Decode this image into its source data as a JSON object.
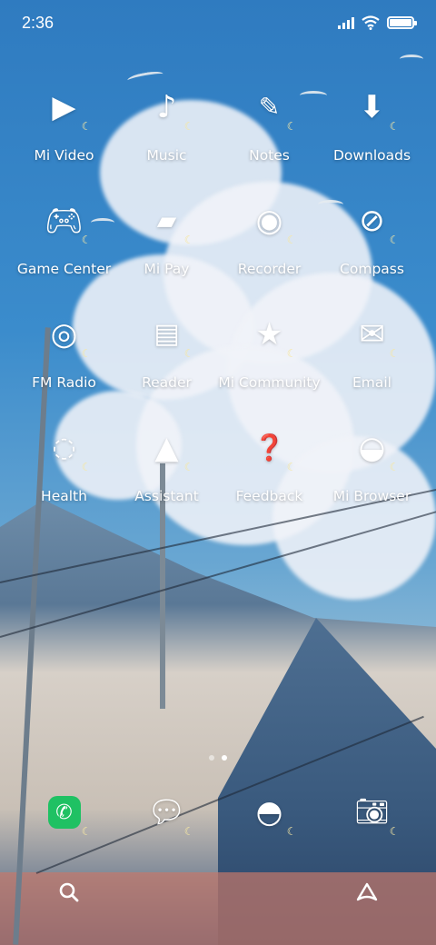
{
  "status_bar": {
    "time": "2:36",
    "icons": [
      "signal-icon",
      "wifi-icon",
      "battery-icon"
    ],
    "battery_level": 1.0
  },
  "apps": [
    {
      "label": "Mi Video",
      "icon": "play-icon"
    },
    {
      "label": "Music",
      "icon": "music-note-icon"
    },
    {
      "label": "Notes",
      "icon": "pencil-icon"
    },
    {
      "label": "Downloads",
      "icon": "download-icon"
    },
    {
      "label": "Game Center",
      "icon": "gamepad-icon"
    },
    {
      "label": "Mi Pay",
      "icon": "card-icon"
    },
    {
      "label": "Recorder",
      "icon": "record-icon"
    },
    {
      "label": "Compass",
      "icon": "compass-icon"
    },
    {
      "label": "FM Radio",
      "icon": "radio-icon"
    },
    {
      "label": "Reader",
      "icon": "book-icon"
    },
    {
      "label": "Mi Community",
      "icon": "community-icon"
    },
    {
      "label": "Email",
      "icon": "mail-icon"
    },
    {
      "label": "Health",
      "icon": "health-icon"
    },
    {
      "label": "Assistant",
      "icon": "assistant-icon"
    },
    {
      "label": "Feedback",
      "icon": "feedback-icon"
    },
    {
      "label": "Mi Browser",
      "icon": "globe-icon"
    }
  ],
  "page_indicator": {
    "pages": 2,
    "current": 2
  },
  "dock": [
    {
      "icon": "phone-icon"
    },
    {
      "icon": "messaging-icon"
    },
    {
      "icon": "browser-icon"
    },
    {
      "icon": "camera-icon"
    }
  ],
  "bottom_bar": {
    "left_icon": "search-icon",
    "right_icon": "assistant-icon"
  },
  "colors": {
    "phone_green": "#1fc163",
    "moon_badge": "#f6e7a3"
  }
}
